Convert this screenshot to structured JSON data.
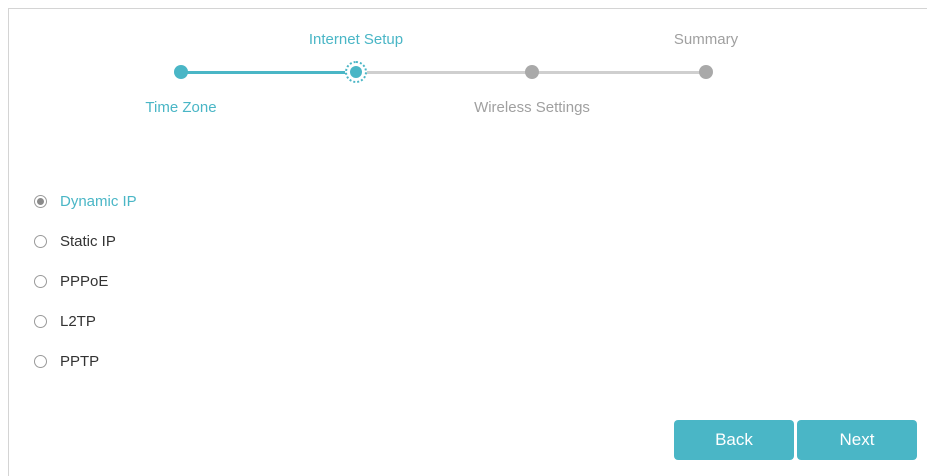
{
  "wizard": {
    "steps": [
      {
        "label": "Time Zone",
        "state": "done"
      },
      {
        "label": "Internet Setup",
        "state": "current"
      },
      {
        "label": "Wireless Settings",
        "state": "todo"
      },
      {
        "label": "Summary",
        "state": "todo"
      }
    ],
    "progress_fraction": 0.333
  },
  "connection_types": {
    "selected": "Dynamic IP",
    "options": [
      {
        "label": "Dynamic IP",
        "checked": true
      },
      {
        "label": "Static IP",
        "checked": false
      },
      {
        "label": "PPPoE",
        "checked": false
      },
      {
        "label": "L2TP",
        "checked": false
      },
      {
        "label": "PPTP",
        "checked": false
      }
    ]
  },
  "buttons": {
    "back_label": "Back",
    "next_label": "Next"
  },
  "colors": {
    "accent": "#4ab6c6",
    "inactive_step": "#a9a9a9",
    "inactive_track": "#cfcfcf",
    "text": "#333333"
  }
}
